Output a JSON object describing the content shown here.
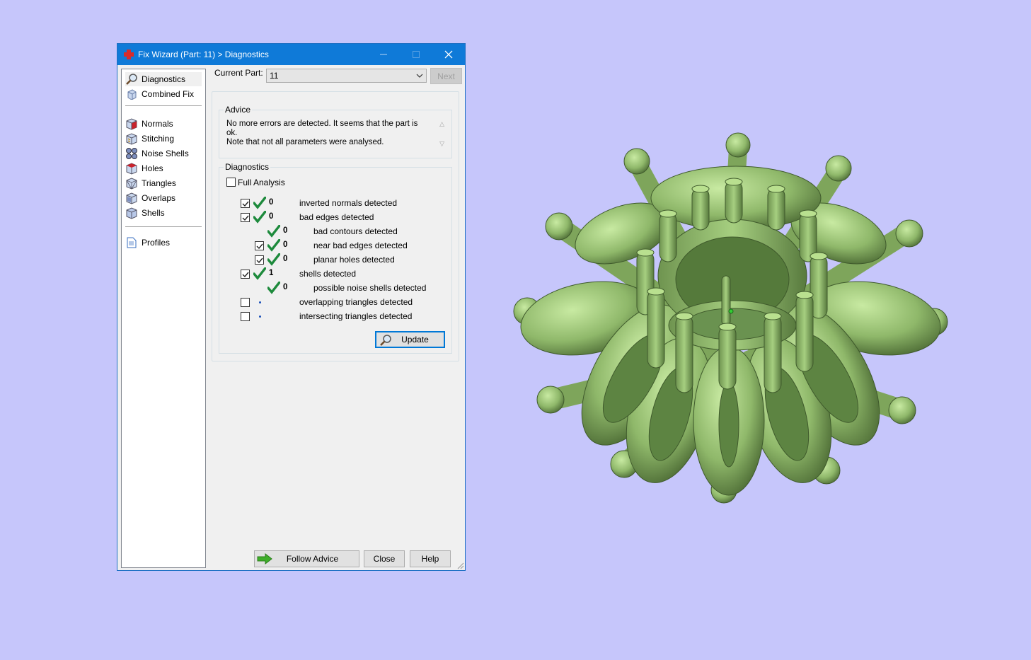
{
  "window": {
    "title": "Fix Wizard (Part: 11) > Diagnostics"
  },
  "sidebar": {
    "items": [
      {
        "label": "Diagnostics",
        "icon": "magnifier-icon"
      },
      {
        "label": "Combined Fix",
        "icon": "cube-icon"
      },
      {
        "label": "Normals",
        "icon": "normals-cube-icon"
      },
      {
        "label": "Stitching",
        "icon": "stitching-cube-icon"
      },
      {
        "label": "Noise Shells",
        "icon": "noise-shells-icon"
      },
      {
        "label": "Holes",
        "icon": "holes-cube-icon"
      },
      {
        "label": "Triangles",
        "icon": "triangles-cube-icon"
      },
      {
        "label": "Overlaps",
        "icon": "overlaps-cube-icon"
      },
      {
        "label": "Shells",
        "icon": "shells-cube-icon"
      },
      {
        "label": "Profiles",
        "icon": "document-icon"
      }
    ]
  },
  "current_part": {
    "label": "Current Part:",
    "value": "11",
    "next_label": "Next"
  },
  "advice": {
    "title": "Advice",
    "line1": "No more errors are detected. It seems that the part is ok.",
    "line2": "Note that not all parameters were analysed."
  },
  "diagnostics": {
    "title": "Diagnostics",
    "full_analysis_label": "Full Analysis",
    "rows": [
      {
        "count": "0",
        "label": "inverted normals detected",
        "checked": true
      },
      {
        "count": "0",
        "label": "bad edges detected",
        "checked": true
      },
      {
        "count": "0",
        "label": "bad contours detected"
      },
      {
        "count": "0",
        "label": "near bad edges detected",
        "checked": true
      },
      {
        "count": "0",
        "label": "planar holes detected",
        "checked": true
      },
      {
        "count": "1",
        "label": "shells detected",
        "checked": true
      },
      {
        "count": "0",
        "label": "possible noise shells detected"
      },
      {
        "count": "",
        "label": "overlapping triangles detected",
        "checked": false
      },
      {
        "count": "",
        "label": "intersecting triangles detected",
        "checked": false
      }
    ],
    "update_label": "Update"
  },
  "footer": {
    "follow_advice_label": "Follow Advice",
    "close_label": "Close",
    "help_label": "Help"
  },
  "colors": {
    "desktop_bg": "#c6c6fb",
    "titlebar": "#0f7ad8",
    "check_green": "#1d8a3c",
    "model_green": "#8fb86a"
  }
}
